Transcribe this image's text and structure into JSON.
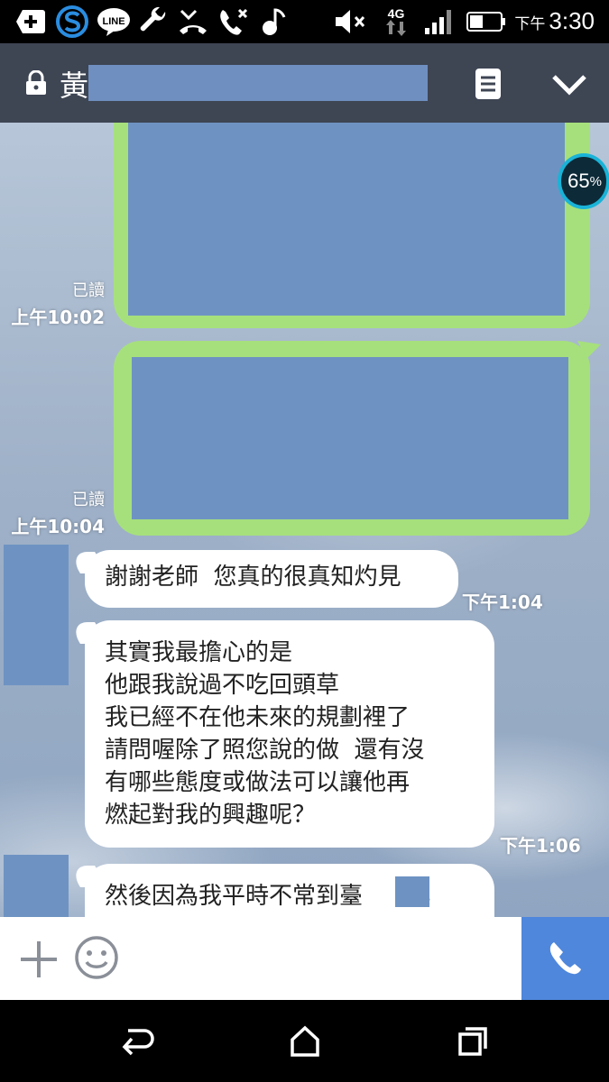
{
  "status_bar": {
    "time_prefix": "下午",
    "time": "3:30",
    "network": "4G",
    "line_badge": "LINE",
    "icons": [
      "plus-square-icon",
      "sync-s-icon",
      "line-app-icon",
      "wrench-icon",
      "missed-call-icon",
      "missed-call-x-icon",
      "music-note-icon",
      "mute-icon",
      "4g-data-icon",
      "signal-icon",
      "battery-icon"
    ]
  },
  "header": {
    "title": "黃",
    "title_redacted": true,
    "icons": [
      "lock-icon",
      "menu-list-icon",
      "chevron-down-icon"
    ]
  },
  "overlay": {
    "percent": "65",
    "unit": "%"
  },
  "messages_sent": [
    {
      "read": "已讀",
      "time": "上午10:02",
      "redacted": true
    },
    {
      "read": "已讀",
      "time": "上午10:04",
      "redacted": true
    }
  ],
  "messages_received": [
    {
      "text": "謝謝老師  您真的很真知灼見",
      "time": "下午1:04"
    },
    {
      "text": "其實我最擔心的是\n他跟我說過不吃回頭草\n我已經不在他未來的規劃裡了\n請問喔除了照您說的做  還有沒\n有哪些態度或做法可以讓他再\n燃起對我的興趣呢？",
      "time": "下午1:06"
    },
    {
      "text": "然後因為我平時不常到臺      其",
      "time": ""
    }
  ],
  "input_bar": {
    "icons": [
      "plus-icon",
      "emoji-icon",
      "phone-icon"
    ]
  },
  "nav_bar": {
    "icons": [
      "back-icon",
      "home-icon",
      "recents-icon"
    ]
  },
  "colors": {
    "header_bg": "#3e4553",
    "sent_bubble": "#a6e07c",
    "redaction": "#6e93c2",
    "call_button": "#4f87dc"
  }
}
